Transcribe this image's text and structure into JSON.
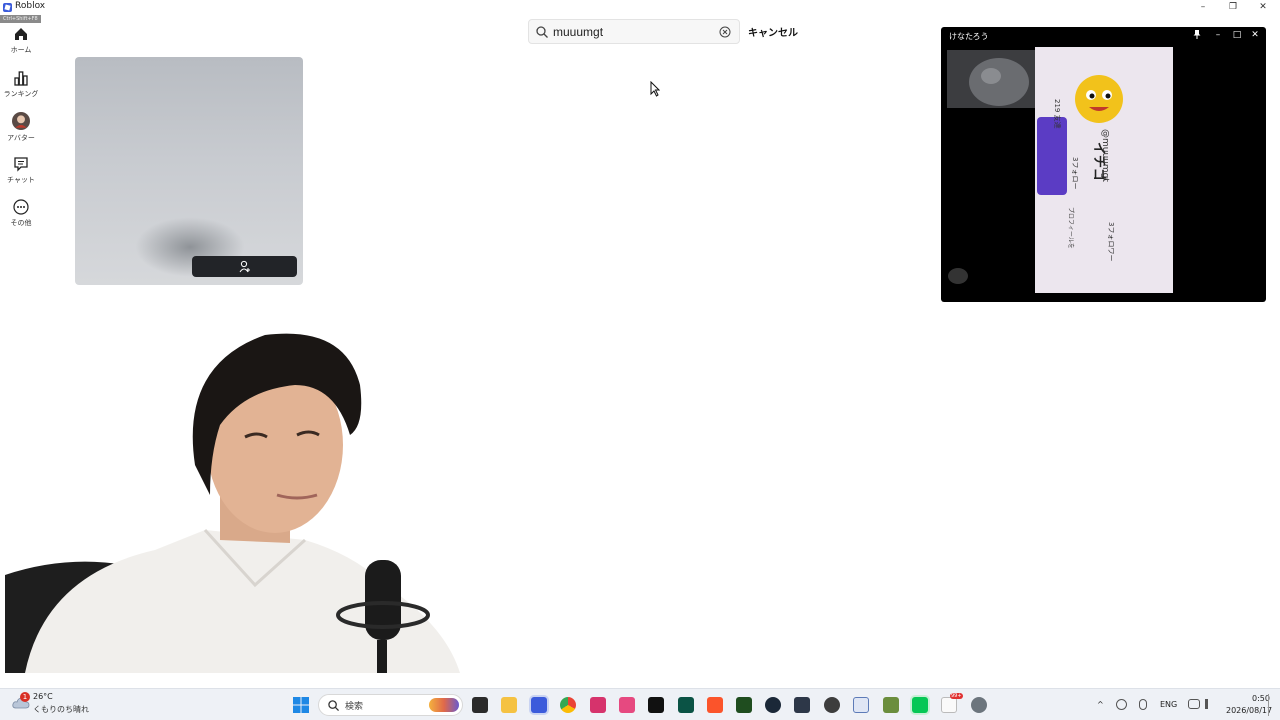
{
  "window": {
    "title": "Roblox",
    "fps_tag": "Ctrl+Shift+F8",
    "controls": [
      "–",
      "❐",
      "✕"
    ]
  },
  "nav": {
    "items": [
      {
        "label": "ホーム",
        "icon": "home-icon"
      },
      {
        "label": "ランキング",
        "icon": "ranking-icon"
      },
      {
        "label": "アバター",
        "icon": "avatar-icon"
      },
      {
        "label": "チャット",
        "icon": "chat-icon"
      },
      {
        "label": "その他",
        "icon": "more-icon"
      }
    ]
  },
  "search": {
    "value": "muuumgt",
    "placeholder": "",
    "cancel_label": "キャンセル"
  },
  "float_window": {
    "title": "けなたろう",
    "phone_text": {
      "name": "イチゴ",
      "handle": "@muuumgt",
      "follow": "3フォロー",
      "followers": "3フォロワー",
      "friends": "219 友達",
      "profile": "プロフィールを"
    }
  },
  "taskbar": {
    "weather": {
      "temp": "26°C",
      "desc": "くもりのち晴れ",
      "alert": "1"
    },
    "search_label": "検索",
    "lang": "ENG",
    "time": "0:50",
    "date": "2026/08/17",
    "notification_count": "99+"
  },
  "colors": {
    "accent": "#3b5bdb",
    "button_dark": "#222428",
    "line_green": "#06c755"
  }
}
